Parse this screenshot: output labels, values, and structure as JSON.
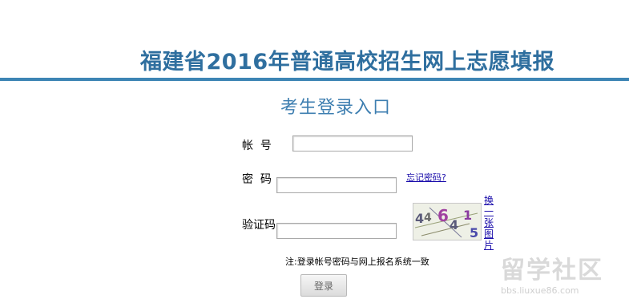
{
  "header": {
    "title": "福建省2016年普通高校招生网上志愿填报"
  },
  "login": {
    "title": "考生登录入口",
    "account_label": "帐  号",
    "password_label": "密  码",
    "captcha_label": "验证码",
    "forgot_link": "忘记密码?",
    "refresh_link": "换一张图片",
    "captcha_text": "446415",
    "note": "注:登录帐号密码与网上报名系统一致",
    "submit_label": "登录"
  },
  "watermark": {
    "text": "留学社区",
    "url": "bbs.liuxue86.com"
  },
  "colors": {
    "title": "#2f6f9f",
    "rule": "#3d85b4",
    "subtitle": "#3d7eb0",
    "link": "#1a0dab"
  }
}
